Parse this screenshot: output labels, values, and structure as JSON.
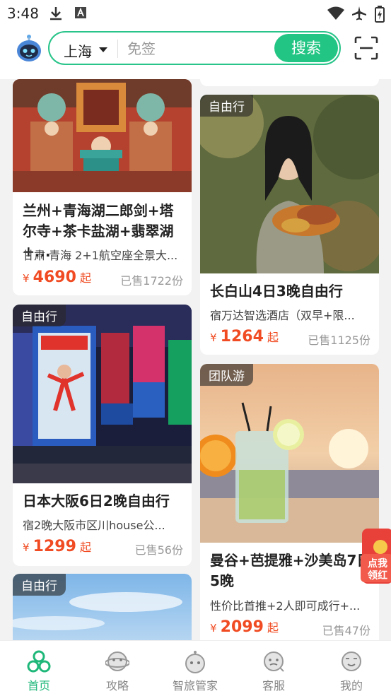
{
  "status_bar": {
    "time": "3:48"
  },
  "header": {
    "city": "上海",
    "search_placeholder": "免签",
    "search_button": "搜索"
  },
  "cards": [
    {
      "title": "兰州+青海湖二郎剑+塔尔寺+茶卡盐湖+翡翠湖+...",
      "desc": "甘肃 青海 2+1航空座全景大...",
      "price": "4690",
      "currency": "¥",
      "price_suffix": "起",
      "sold": "已售1722份"
    },
    {
      "tag": "自由行",
      "title": "长白山4日3晚自由行",
      "desc": "宿万达智选酒店（双早+限...",
      "price": "1264",
      "currency": "¥",
      "price_suffix": "起",
      "sold": "已售1125份"
    },
    {
      "tag": "自由行",
      "title": "日本大阪6日2晚自由行",
      "desc": "宿2晚大阪市区川house公...",
      "price": "1299",
      "currency": "¥",
      "price_suffix": "起",
      "sold": "已售56份"
    },
    {
      "tag": "团队游",
      "title": "曼谷+芭提雅+沙美岛7日5晚",
      "desc": "性价比首推+2人即可成行+...",
      "price": "2099",
      "currency": "¥",
      "price_suffix": "起",
      "sold": "已售47份"
    },
    {
      "tag": "自由行"
    }
  ],
  "float_badge": {
    "line1": "点我",
    "line2": "领红"
  },
  "tabbar": {
    "items": [
      {
        "label": "首页",
        "active": true
      },
      {
        "label": "攻略"
      },
      {
        "label": "智旅管家"
      },
      {
        "label": "客服"
      },
      {
        "label": "我的"
      }
    ]
  },
  "colors": {
    "accent": "#22c583",
    "price": "#f04b22"
  }
}
